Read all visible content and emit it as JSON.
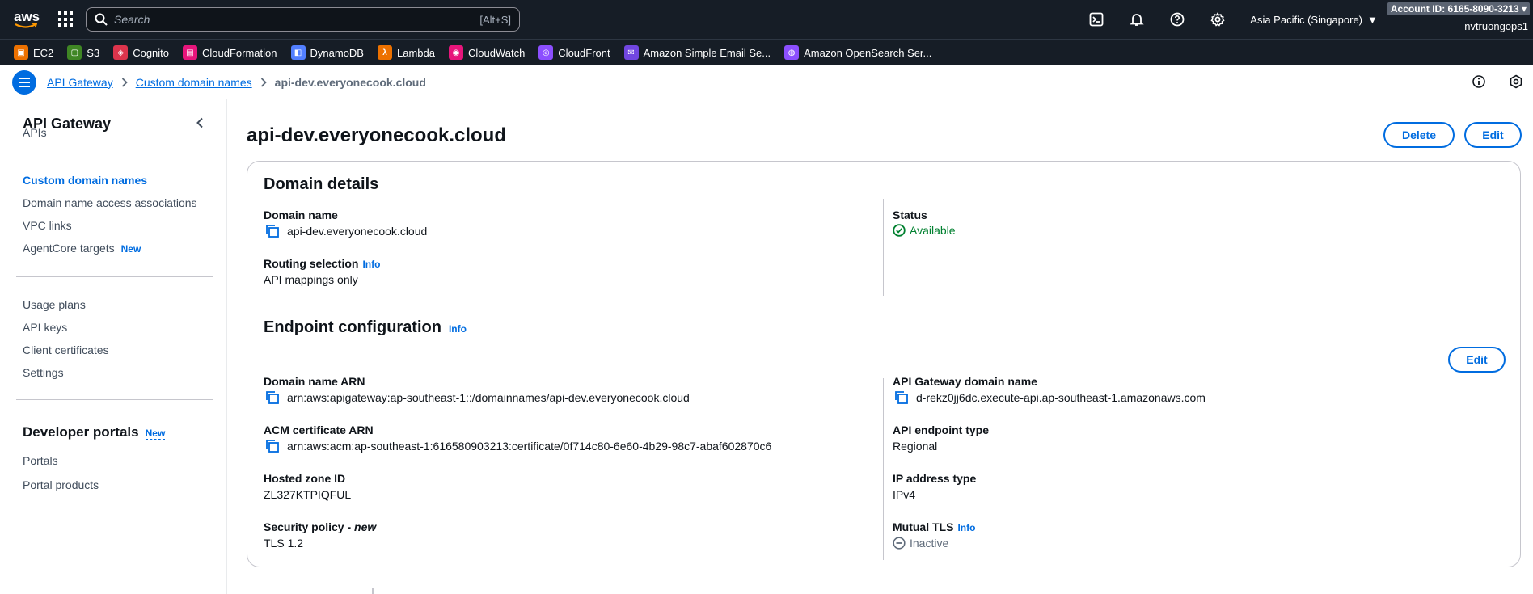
{
  "topnav": {
    "logo_text": "aws",
    "search_placeholder": "Search",
    "search_shortcut": "[Alt+S]",
    "region": "Asia Pacific (Singapore)",
    "account_id": "Account ID: 6165-8090-3213",
    "username": "nvtruongops1"
  },
  "favorites": [
    {
      "label": "EC2",
      "color": "#ed7100"
    },
    {
      "label": "S3",
      "color": "#3f8624"
    },
    {
      "label": "Cognito",
      "color": "#dd344c"
    },
    {
      "label": "CloudFormation",
      "color": "#e7157b"
    },
    {
      "label": "DynamoDB",
      "color": "#527fff"
    },
    {
      "label": "Lambda",
      "color": "#ed7100"
    },
    {
      "label": "CloudWatch",
      "color": "#e7157b"
    },
    {
      "label": "CloudFront",
      "color": "#8c4fff"
    },
    {
      "label": "Amazon Simple Email Se...",
      "color": "#7146e0"
    },
    {
      "label": "Amazon OpenSearch Ser...",
      "color": "#8c4fff"
    }
  ],
  "breadcrumb": {
    "items": [
      "API Gateway",
      "Custom domain names"
    ],
    "current": "api-dev.everyonecook.cloud"
  },
  "sidebar": {
    "title": "API Gateway",
    "items_group1": [
      "APIs",
      "Custom domain names",
      "Domain name access associations",
      "VPC links",
      "AgentCore targets"
    ],
    "new_badge": "New",
    "items_group2": [
      "Usage plans",
      "API keys",
      "Client certificates",
      "Settings"
    ],
    "section2_title": "Developer portals",
    "items_group3": [
      "Portals",
      "Portal products"
    ]
  },
  "page": {
    "title": "api-dev.everyonecook.cloud",
    "delete_label": "Delete",
    "edit_label": "Edit"
  },
  "domain_details": {
    "title": "Domain details",
    "domain_name_label": "Domain name",
    "domain_name_value": "api-dev.everyonecook.cloud",
    "routing_label": "Routing selection",
    "info": "Info",
    "routing_value": "API mappings only",
    "status_label": "Status",
    "status_value": "Available"
  },
  "endpoint_config": {
    "title": "Endpoint configuration",
    "info": "Info",
    "edit_label": "Edit",
    "domain_arn_label": "Domain name ARN",
    "domain_arn_value": "arn:aws:apigateway:ap-southeast-1::/domainnames/api-dev.everyonecook.cloud",
    "acm_label": "ACM certificate ARN",
    "acm_value": "arn:aws:acm:ap-southeast-1:616580903213:certificate/0f714c80-6e60-4b29-98c7-abaf602870c6",
    "hosted_zone_label": "Hosted zone ID",
    "hosted_zone_value": "ZL327KTPIQFUL",
    "security_policy_label": "Security policy - ",
    "security_policy_new": "new",
    "security_policy_value": "TLS 1.2",
    "apigw_domain_label": "API Gateway domain name",
    "apigw_domain_value": "d-rekz0jj6dc.execute-api.ap-southeast-1.amazonaws.com",
    "endpoint_type_label": "API endpoint type",
    "endpoint_type_value": "Regional",
    "ip_type_label": "IP address type",
    "ip_type_value": "IPv4",
    "mtls_label": "Mutual TLS",
    "mtls_value": "Inactive"
  }
}
